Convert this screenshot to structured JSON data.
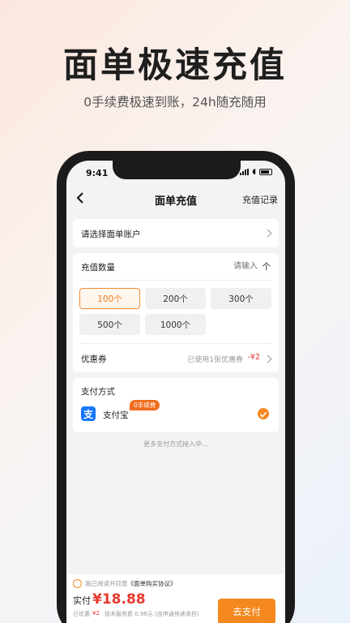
{
  "promo": {
    "title": "面单极速充值",
    "subtitle": "0手续费极速到账，24h随充随用"
  },
  "status_bar": {
    "time": "9:41"
  },
  "navbar": {
    "title": "面单充值",
    "record_link": "充值记录"
  },
  "account": {
    "placeholder": "请选择面单账户"
  },
  "quantity": {
    "label": "充值数量",
    "input_placeholder": "请输入",
    "unit": "个",
    "options": [
      "100个",
      "200个",
      "300个",
      "500个",
      "1000个"
    ],
    "selected_index": 0
  },
  "coupon": {
    "label": "优惠券",
    "used_text": "已使用1张优惠券",
    "discount": "-¥2"
  },
  "payment": {
    "section_label": "支付方式",
    "method": "支付宝",
    "badge": "0手续费",
    "more_text": "更多支付方式接入中...",
    "brand_color": "#1677ff"
  },
  "checkout": {
    "agreement_prefix": "我已阅读并同意",
    "agreement_link": "《面单购买协议》",
    "total_label": "实付",
    "total_amount": "¥18.88",
    "discount_label": "已优惠",
    "discount_amount": "¥2",
    "fee_text": "技术服务费 0.96元 (由申通快递承担)",
    "pay_button": "去支付"
  },
  "colors": {
    "accent": "#f5891f",
    "price": "#e8382f"
  }
}
